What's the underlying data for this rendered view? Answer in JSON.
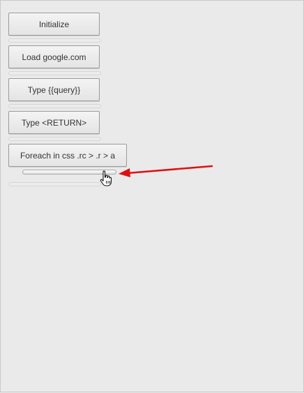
{
  "buttons": {
    "initialize": "Initialize",
    "load": "Load google.com",
    "type_query": "Type {{query}}",
    "type_return": "Type <RETURN>",
    "foreach": "Foreach in css .rc > .r > a"
  },
  "colors": {
    "background": "#eaeaea",
    "annotation_arrow": "#e01010"
  },
  "icons": {
    "cursor": "hand-pointer-icon",
    "annotation": "red-arrow-icon"
  }
}
